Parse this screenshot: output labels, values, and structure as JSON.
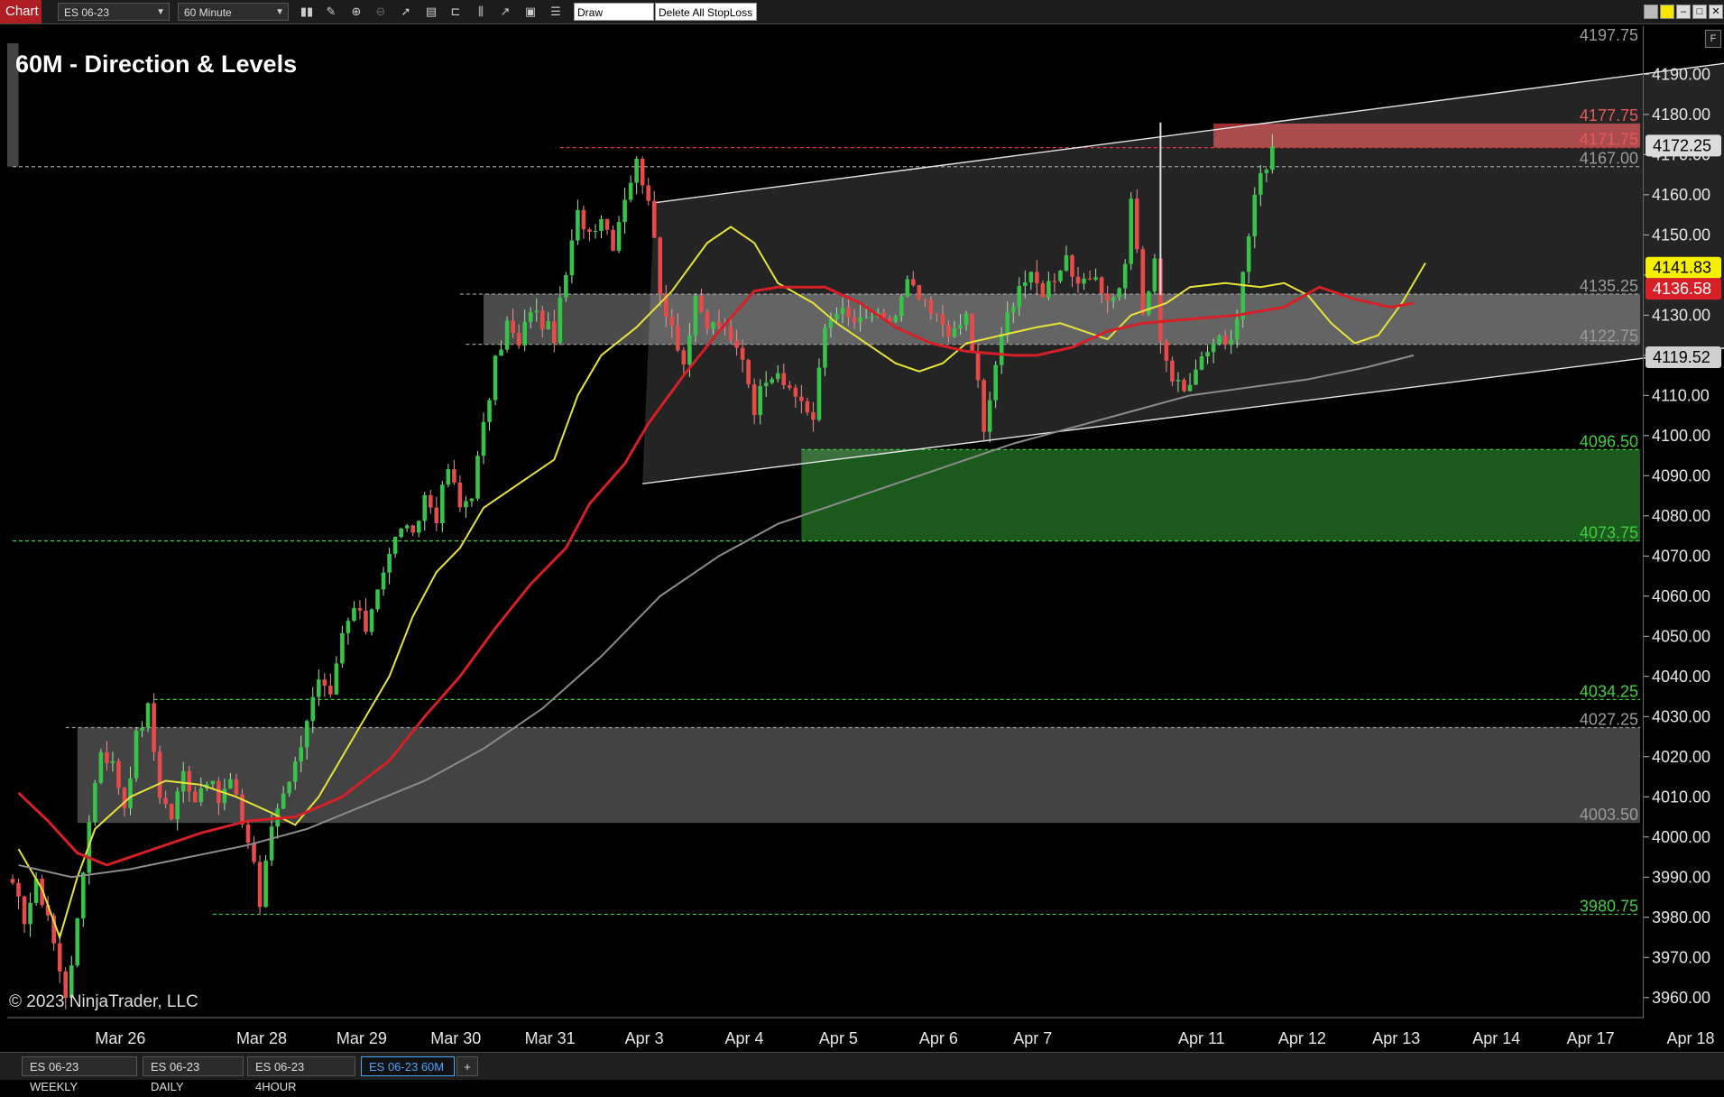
{
  "toolbar": {
    "chart_tab": "Chart",
    "instrument": "ES 06-23",
    "timeframe": "60 Minute",
    "draw_stoploss": "Draw StopLoss",
    "delete_stoploss": "Delete All StopLoss"
  },
  "chart": {
    "title": "60M - Direction & Levels",
    "copyright": "© 2023 NinjaTrader, LLC",
    "f_label": "F"
  },
  "bottom_tabs": [
    {
      "label": "ES 06-23 WEEKLY"
    },
    {
      "label": "ES 06-23 DAILY"
    },
    {
      "label": "ES 06-23 4HOUR"
    },
    {
      "label": "ES 06-23 60M"
    }
  ],
  "add_tab": "+",
  "colors": {
    "bull": "#37c24a",
    "bear": "#e84a4a",
    "ema_fast": "#e8e33a",
    "ema_mid": "#d61f26",
    "ema_slow": "#8c8c8c",
    "support_zone": "#1c5e1f",
    "resistance_zone": "#b8373b",
    "neutral_zone": "#5a5a5a",
    "accent": "#b01e23"
  },
  "chart_data": {
    "type": "candlestick",
    "title": "60M - Direction & Levels",
    "instrument": "ES 06-23",
    "ylim": [
      3955,
      4202
    ],
    "y_ticks": [
      "4190.00",
      "4180.00",
      "4170.00",
      "4160.00",
      "4150.00",
      "4140.00",
      "4130.00",
      "4120.00",
      "4110.00",
      "4100.00",
      "4090.00",
      "4080.00",
      "4070.00",
      "4060.00",
      "4050.00",
      "4040.00",
      "4030.00",
      "4020.00",
      "4010.00",
      "4000.00",
      "3990.00",
      "3980.00",
      "3970.00",
      "3960.00"
    ],
    "y_tick_values": [
      4190,
      4180,
      4170,
      4160,
      4150,
      4140,
      4130,
      4120,
      4110,
      4100,
      4090,
      4080,
      4070,
      4060,
      4050,
      4040,
      4030,
      4020,
      4010,
      4000,
      3990,
      3980,
      3970,
      3960
    ],
    "x_labels": [
      "Mar 26",
      "Mar 28",
      "Mar 29",
      "Mar 30",
      "Mar 31",
      "Apr 3",
      "Apr 4",
      "Apr 5",
      "Apr 6",
      "Apr 7",
      "Apr 11",
      "Apr 12",
      "Apr 13",
      "Apr 14",
      "Apr 17",
      "Apr 18"
    ],
    "x_label_bar_index": [
      14,
      38,
      55,
      71,
      87,
      104,
      121,
      137,
      154,
      170,
      198,
      215,
      231,
      248,
      264,
      281
    ],
    "price_badges": [
      {
        "value": "4172.25",
        "bg": "#dcdcdc",
        "fg": "#000000"
      },
      {
        "value": "4141.83",
        "bg": "#f5f000",
        "fg": "#000000"
      },
      {
        "value": "4136.58",
        "bg": "#d61f26",
        "fg": "#ffffff"
      },
      {
        "value": "4119.52",
        "bg": "#cfcfcf",
        "fg": "#000000"
      }
    ],
    "levels": [
      {
        "label": "4197.75",
        "price": 4197.75,
        "color": "#9a9a9a",
        "line": false
      },
      {
        "label": "4177.75",
        "price": 4177.75,
        "color": "#e85a5a",
        "line": false
      },
      {
        "label": "4171.75",
        "price": 4171.75,
        "color": "#e85a5a",
        "line": true,
        "line_color": "#d43a3a",
        "from_bar": 93
      },
      {
        "label": "4167.00",
        "price": 4167.0,
        "color": "#9a9a9a",
        "line": true,
        "line_color": "#9a9a9a",
        "from_bar": 0
      },
      {
        "label": "4135.25",
        "price": 4135.25,
        "color": "#9a9a9a",
        "line": true,
        "line_color": "#9a9a9a",
        "from_bar": 76
      },
      {
        "label": "4122.75",
        "price": 4122.75,
        "color": "#9a9a9a",
        "line": true,
        "line_color": "#9a9a9a",
        "from_bar": 77
      },
      {
        "label": "4096.50",
        "price": 4096.5,
        "color": "#3ecf3e",
        "line": true,
        "line_color": "#3ecf3e",
        "from_bar": 134
      },
      {
        "label": "4073.75",
        "price": 4073.75,
        "color": "#3ecf3e",
        "line": true,
        "line_color": "#3ecf3e",
        "from_bar": 0
      },
      {
        "label": "4034.25",
        "price": 4034.25,
        "color": "#3ecf3e",
        "line": true,
        "line_color": "#3ecf3e",
        "from_bar": 24
      },
      {
        "label": "4027.25",
        "price": 4027.25,
        "color": "#9a9a9a",
        "line": true,
        "line_color": "#9a9a9a",
        "from_bar": 9
      },
      {
        "label": "4003.50",
        "price": 4003.5,
        "color": "#9a9a9a",
        "line": false
      },
      {
        "label": "3980.75",
        "price": 3980.75,
        "color": "#3ecf3e",
        "line": true,
        "line_color": "#3ecf3e",
        "from_bar": 34
      }
    ],
    "zones": [
      {
        "from_bar": 0,
        "to_bar": 1,
        "hi": 4197.75,
        "lo": 4167.0,
        "fill": "#4f4f4f",
        "full_width": true
      },
      {
        "from_bar": 204,
        "to_bar": 300,
        "hi": 4177.75,
        "lo": 4171.75,
        "fill": "#b8373b",
        "full_width": false
      },
      {
        "from_bar": 80,
        "to_bar": 300,
        "hi": 4135.25,
        "lo": 4122.75,
        "fill": "#585858",
        "full_width": false
      },
      {
        "from_bar": 134,
        "to_bar": 300,
        "hi": 4096.5,
        "lo": 4073.75,
        "fill": "#1c5e1f",
        "full_width": false
      },
      {
        "from_bar": 11,
        "to_bar": 300,
        "hi": 4027.25,
        "lo": 4003.5,
        "fill": "#4f4f4f",
        "full_width": false
      }
    ],
    "channel": {
      "upper": [
        [
          109,
          4158
        ],
        [
          300,
          4194.5
        ]
      ],
      "lower": [
        [
          107,
          4088
        ],
        [
          300,
          4123.5
        ]
      ]
    },
    "series": [
      {
        "name": "EMA fast",
        "color": "#e8e33a",
        "points": [
          [
            1,
            3997
          ],
          [
            5,
            3987
          ],
          [
            8,
            3975
          ],
          [
            11,
            3990
          ],
          [
            14,
            4002
          ],
          [
            20,
            4010
          ],
          [
            26,
            4014
          ],
          [
            32,
            4013
          ],
          [
            38,
            4010
          ],
          [
            44,
            4006
          ],
          [
            48,
            4003
          ],
          [
            52,
            4010
          ],
          [
            56,
            4020
          ],
          [
            60,
            4030
          ],
          [
            64,
            4040
          ],
          [
            68,
            4055
          ],
          [
            72,
            4066
          ],
          [
            76,
            4072
          ],
          [
            80,
            4082
          ],
          [
            86,
            4088
          ],
          [
            92,
            4094
          ],
          [
            96,
            4110
          ],
          [
            100,
            4120
          ],
          [
            106,
            4127
          ],
          [
            112,
            4136
          ],
          [
            118,
            4148
          ],
          [
            122,
            4152
          ],
          [
            126,
            4148
          ],
          [
            130,
            4138
          ],
          [
            136,
            4133
          ],
          [
            140,
            4128
          ],
          [
            146,
            4122
          ],
          [
            150,
            4118
          ],
          [
            154,
            4116
          ],
          [
            158,
            4118
          ],
          [
            162,
            4123
          ],
          [
            168,
            4125
          ],
          [
            174,
            4127
          ],
          [
            178,
            4128
          ],
          [
            182,
            4126
          ],
          [
            186,
            4124
          ],
          [
            190,
            4130
          ],
          [
            196,
            4133
          ],
          [
            200,
            4137
          ],
          [
            206,
            4138
          ],
          [
            212,
            4137
          ],
          [
            216,
            4138
          ],
          [
            220,
            4135
          ],
          [
            224,
            4128
          ],
          [
            228,
            4123
          ],
          [
            232,
            4125
          ],
          [
            236,
            4133
          ],
          [
            240,
            4143
          ]
        ]
      },
      {
        "name": "EMA mid",
        "color": "#d61f26",
        "points": [
          [
            1,
            4011
          ],
          [
            6,
            4004
          ],
          [
            11,
            3996
          ],
          [
            16,
            3993
          ],
          [
            24,
            3997
          ],
          [
            32,
            4001
          ],
          [
            40,
            4004
          ],
          [
            48,
            4005
          ],
          [
            56,
            4010
          ],
          [
            64,
            4019
          ],
          [
            70,
            4030
          ],
          [
            76,
            4040
          ],
          [
            82,
            4052
          ],
          [
            88,
            4063
          ],
          [
            94,
            4072
          ],
          [
            98,
            4083
          ],
          [
            104,
            4093
          ],
          [
            108,
            4103
          ],
          [
            114,
            4115
          ],
          [
            120,
            4126
          ],
          [
            126,
            4136
          ],
          [
            130,
            4137
          ],
          [
            138,
            4137
          ],
          [
            144,
            4133
          ],
          [
            150,
            4127
          ],
          [
            156,
            4123
          ],
          [
            162,
            4121
          ],
          [
            170,
            4120
          ],
          [
            174,
            4120
          ],
          [
            180,
            4122
          ],
          [
            186,
            4126
          ],
          [
            192,
            4128
          ],
          [
            200,
            4129
          ],
          [
            208,
            4130
          ],
          [
            216,
            4132
          ],
          [
            222,
            4137
          ],
          [
            228,
            4134
          ],
          [
            234,
            4132
          ],
          [
            238,
            4133
          ]
        ]
      },
      {
        "name": "EMA slow",
        "color": "#8c8c8c",
        "points": [
          [
            1,
            3993
          ],
          [
            10,
            3990
          ],
          [
            20,
            3992
          ],
          [
            30,
            3995
          ],
          [
            40,
            3998
          ],
          [
            50,
            4002
          ],
          [
            60,
            4008
          ],
          [
            70,
            4014
          ],
          [
            80,
            4022
          ],
          [
            90,
            4032
          ],
          [
            100,
            4045
          ],
          [
            110,
            4060
          ],
          [
            120,
            4070
          ],
          [
            130,
            4078
          ],
          [
            140,
            4083
          ],
          [
            150,
            4088
          ],
          [
            160,
            4093
          ],
          [
            170,
            4098
          ],
          [
            180,
            4102
          ],
          [
            190,
            4106
          ],
          [
            200,
            4110
          ],
          [
            210,
            4112
          ],
          [
            220,
            4114
          ],
          [
            230,
            4117
          ],
          [
            238,
            4120
          ]
        ]
      }
    ],
    "candles": {
      "anchors": [
        [
          0,
          3987
        ],
        [
          2,
          3980
        ],
        [
          4,
          3988
        ],
        [
          6,
          3981
        ],
        [
          8,
          3966
        ],
        [
          9,
          3961
        ],
        [
          11,
          3978
        ],
        [
          13,
          4005
        ],
        [
          15,
          4022
        ],
        [
          17,
          4018
        ],
        [
          19,
          4008
        ],
        [
          21,
          4025
        ],
        [
          23,
          4032
        ],
        [
          25,
          4011
        ],
        [
          27,
          4005
        ],
        [
          29,
          4016
        ],
        [
          31,
          4010
        ],
        [
          33,
          4015
        ],
        [
          35,
          4009
        ],
        [
          37,
          4014
        ],
        [
          39,
          4004
        ],
        [
          41,
          3994
        ],
        [
          42,
          3983
        ],
        [
          44,
          4003
        ],
        [
          46,
          4012
        ],
        [
          48,
          4018
        ],
        [
          50,
          4030
        ],
        [
          52,
          4038
        ],
        [
          54,
          4034
        ],
        [
          56,
          4050
        ],
        [
          58,
          4057
        ],
        [
          60,
          4052
        ],
        [
          62,
          4063
        ],
        [
          64,
          4070
        ],
        [
          66,
          4078
        ],
        [
          68,
          4074
        ],
        [
          70,
          4085
        ],
        [
          72,
          4080
        ],
        [
          74,
          4092
        ],
        [
          76,
          4082
        ],
        [
          78,
          4086
        ],
        [
          80,
          4102
        ],
        [
          82,
          4118
        ],
        [
          84,
          4128
        ],
        [
          86,
          4122
        ],
        [
          88,
          4132
        ],
        [
          90,
          4128
        ],
        [
          92,
          4125
        ],
        [
          94,
          4140
        ],
        [
          96,
          4155
        ],
        [
          98,
          4151
        ],
        [
          100,
          4155
        ],
        [
          102,
          4148
        ],
        [
          104,
          4160
        ],
        [
          106,
          4168
        ],
        [
          108,
          4160
        ],
        [
          110,
          4135
        ],
        [
          112,
          4128
        ],
        [
          114,
          4118
        ],
        [
          116,
          4133
        ],
        [
          118,
          4127
        ],
        [
          120,
          4128
        ],
        [
          122,
          4123
        ],
        [
          124,
          4120
        ],
        [
          126,
          4107
        ],
        [
          128,
          4115
        ],
        [
          130,
          4117
        ],
        [
          132,
          4110
        ],
        [
          134,
          4109
        ],
        [
          136,
          4104
        ],
        [
          138,
          4127
        ],
        [
          140,
          4132
        ],
        [
          142,
          4129
        ],
        [
          144,
          4128
        ],
        [
          146,
          4130
        ],
        [
          148,
          4128
        ],
        [
          150,
          4130
        ],
        [
          152,
          4138
        ],
        [
          154,
          4134
        ],
        [
          156,
          4130
        ],
        [
          158,
          4128
        ],
        [
          160,
          4125
        ],
        [
          162,
          4130
        ],
        [
          164,
          4113
        ],
        [
          165,
          4100
        ],
        [
          167,
          4118
        ],
        [
          169,
          4130
        ],
        [
          171,
          4138
        ],
        [
          173,
          4139
        ],
        [
          175,
          4136
        ],
        [
          177,
          4140
        ],
        [
          179,
          4145
        ],
        [
          181,
          4136
        ],
        [
          183,
          4139
        ],
        [
          185,
          4136
        ],
        [
          187,
          4134
        ],
        [
          189,
          4142
        ],
        [
          190,
          4160
        ],
        [
          192,
          4130
        ],
        [
          194,
          4143
        ],
        [
          195,
          4125
        ],
        [
          197,
          4114
        ],
        [
          199,
          4111
        ],
        [
          201,
          4118
        ],
        [
          203,
          4122
        ],
        [
          205,
          4125
        ],
        [
          207,
          4122
        ],
        [
          209,
          4140
        ],
        [
          211,
          4160
        ],
        [
          213,
          4168
        ],
        [
          214,
          4172
        ]
      ],
      "seed": 17,
      "total_bars": 300
    },
    "wicks_highlight": [
      {
        "bar": 195,
        "hi": 4178.0,
        "lo": 4135.0,
        "color": "#e0e0e0"
      }
    ],
    "grid": false,
    "legend": "none"
  }
}
